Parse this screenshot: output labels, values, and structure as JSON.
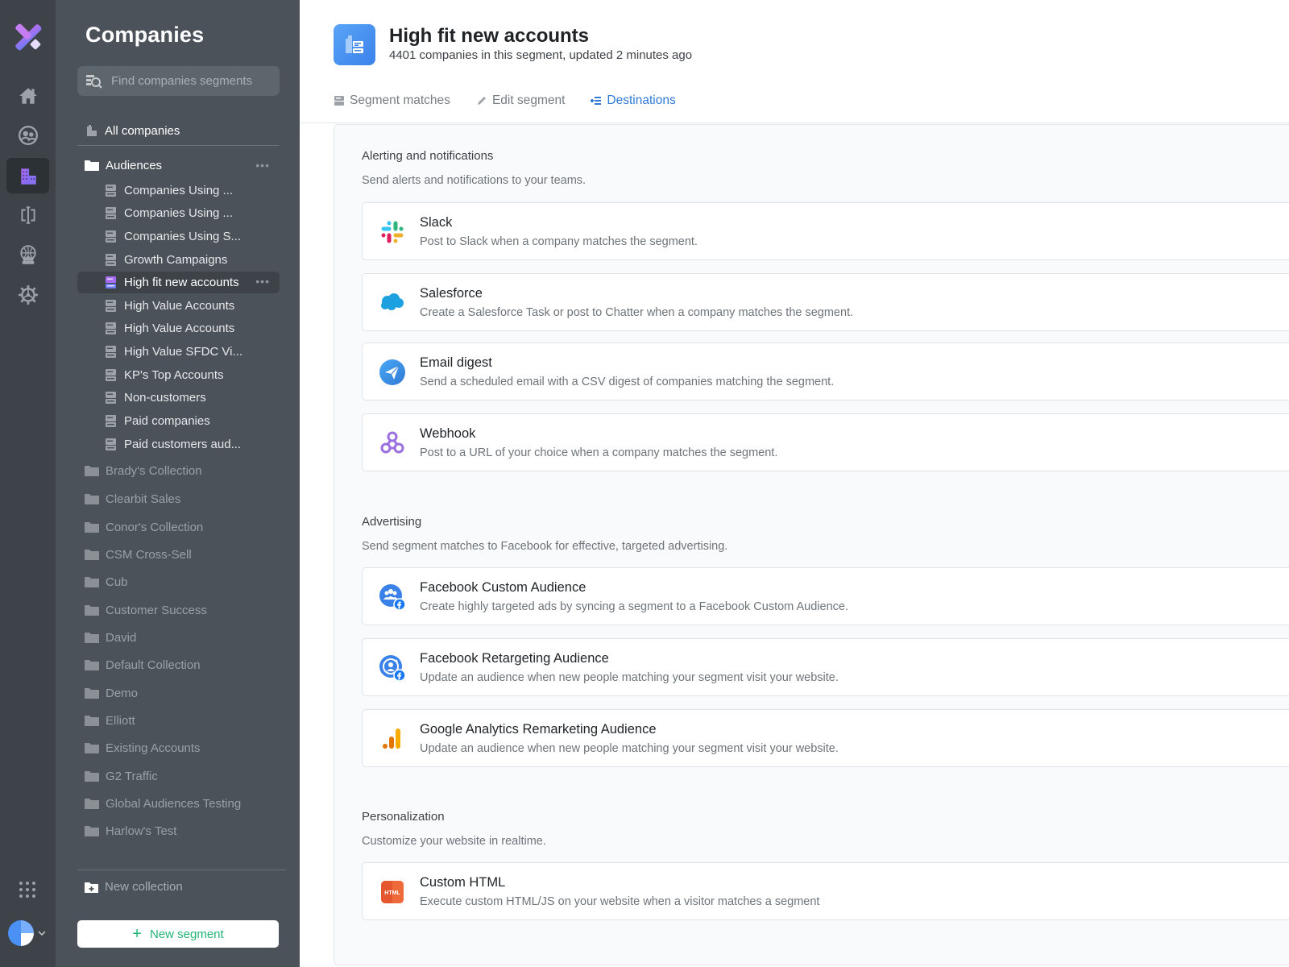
{
  "rail": {
    "items": [
      {
        "name": "home",
        "active": false
      },
      {
        "name": "people",
        "active": false
      },
      {
        "name": "companies",
        "active": true
      },
      {
        "name": "enrichment",
        "active": false
      },
      {
        "name": "audiences",
        "active": false
      },
      {
        "name": "settings",
        "active": false
      }
    ]
  },
  "sidebar": {
    "title": "Companies",
    "search_placeholder": "Find companies segments",
    "all_companies": "All companies",
    "open_folder": {
      "label": "Audiences",
      "more": "•••",
      "segments": [
        {
          "label": "Companies Using ...",
          "active": false
        },
        {
          "label": "Companies Using ...",
          "active": false
        },
        {
          "label": "Companies Using S...",
          "active": false
        },
        {
          "label": "Growth Campaigns",
          "active": false
        },
        {
          "label": "High fit new accounts",
          "active": true
        },
        {
          "label": "High Value Accounts",
          "active": false
        },
        {
          "label": "High Value Accounts",
          "active": false
        },
        {
          "label": "High Value SFDC Vi...",
          "active": false
        },
        {
          "label": "KP's Top Accounts",
          "active": false
        },
        {
          "label": "Non-customers",
          "active": false
        },
        {
          "label": "Paid companies",
          "active": false
        },
        {
          "label": "Paid customers aud...",
          "active": false
        }
      ]
    },
    "folders": [
      "Brady's Collection",
      "Clearbit Sales",
      "Conor's Collection",
      "CSM Cross-Sell",
      "Cub",
      "Customer Success",
      "David",
      "Default Collection",
      "Demo",
      "Elliott",
      "Existing Accounts",
      "G2 Traffic",
      "Global Audiences Testing",
      "Harlow's Test"
    ],
    "new_collection": "New collection",
    "new_segment": "New segment",
    "new_segment_plus": "+"
  },
  "header": {
    "title": "High fit new accounts",
    "subtitle": "4401 companies in this segment, updated 2 minutes ago"
  },
  "tabs": [
    {
      "label": "Segment matches",
      "active": false
    },
    {
      "label": "Edit segment",
      "active": false
    },
    {
      "label": "Destinations",
      "active": true
    }
  ],
  "sections": [
    {
      "title": "Alerting and notifications",
      "description": "Send alerts and notifications to your teams.",
      "destinations": [
        {
          "icon": "slack-icon",
          "name": "Slack",
          "description": "Post to Slack when a company matches the segment."
        },
        {
          "icon": "salesforce-icon",
          "name": "Salesforce",
          "description": "Create a Salesforce Task or post to Chatter when a company matches the segment."
        },
        {
          "icon": "email-digest-icon",
          "name": "Email digest",
          "description": "Send a scheduled email with a CSV digest of companies matching the segment."
        },
        {
          "icon": "webhook-icon",
          "name": "Webhook",
          "description": "Post to a URL of your choice when a company matches the segment."
        }
      ]
    },
    {
      "title": "Advertising",
      "description": "Send segment matches to Facebook for effective, targeted advertising.",
      "destinations": [
        {
          "icon": "facebook-custom-audience-icon",
          "name": "Facebook Custom Audience",
          "description": "Create highly targeted ads by syncing a segment to a Facebook Custom Audience."
        },
        {
          "icon": "facebook-retargeting-icon",
          "name": "Facebook Retargeting Audience",
          "description": "Update an audience when new people matching your segment visit your website."
        },
        {
          "icon": "google-analytics-icon",
          "name": "Google Analytics Remarketing Audience",
          "description": "Update an audience when new people matching your segment visit your website."
        }
      ]
    },
    {
      "title": "Personalization",
      "description": "Customize your website in realtime.",
      "destinations": [
        {
          "icon": "custom-html-icon",
          "name": "Custom HTML",
          "description": "Execute custom HTML/JS on your website when a visitor matches a segment"
        }
      ]
    }
  ],
  "html_badge": "HTML",
  "colors": {
    "accent_blue": "#2f7ad6",
    "new_segment_green": "#22b573",
    "active_purple": "#8b5cf6",
    "sidebar_bg": "#4b5259",
    "rail_bg": "#3d4349"
  }
}
